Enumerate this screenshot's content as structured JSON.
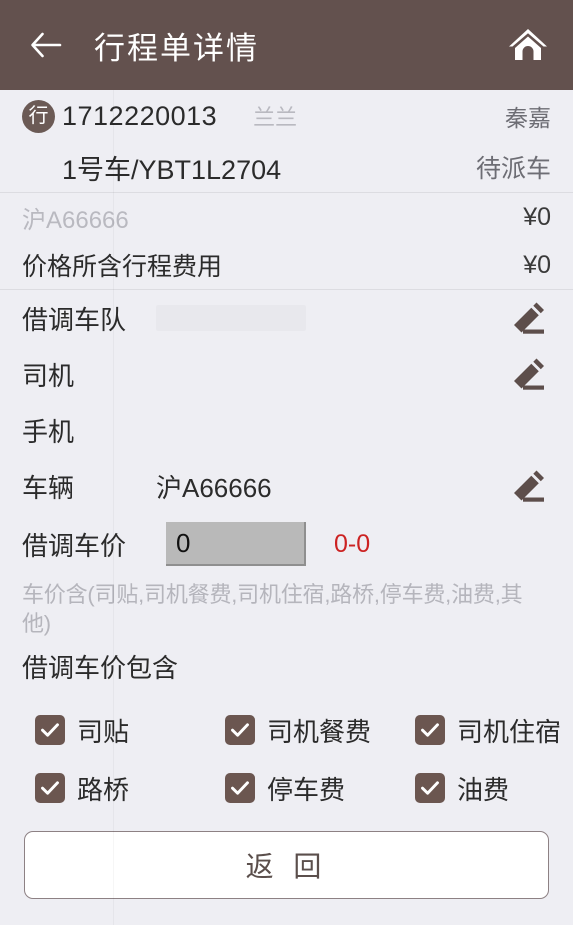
{
  "header": {
    "back_icon": "back-arrow-icon",
    "title": "行程单详情",
    "home_icon": "home-icon",
    "bg_color": "#63514E"
  },
  "order": {
    "badge_text": "行",
    "order_no": "1712220013",
    "customer": "兰兰",
    "agent": "秦嘉",
    "car_label": "1号车/YBT1L2704",
    "status": "待派车"
  },
  "fees": [
    {
      "label": "沪A66666",
      "amount": "¥0",
      "muted": true
    },
    {
      "label": "价格所含行程费用",
      "amount": "¥0",
      "muted": false
    }
  ],
  "details": [
    {
      "label": "借调车队",
      "value": "",
      "edit_icon": "pencil-icon",
      "editable": true
    },
    {
      "label": "司机",
      "value": "",
      "edit_icon": "pencil-icon",
      "editable": true
    },
    {
      "label": "手机",
      "value": "",
      "edit_icon": "",
      "editable": false
    },
    {
      "label": "车辆",
      "value": "沪A66666",
      "edit_icon": "pencil-icon",
      "editable": true
    }
  ],
  "price": {
    "label": "借调车价",
    "input_value": "0",
    "input_placeholder": "0",
    "range": "0-0",
    "range_color": "#CC2222",
    "hint": "车价含(司贴,司机餐费,司机住宿,路桥,停车费,油费,其他)"
  },
  "includes": {
    "title": "借调车价包含",
    "checkbox_color": "#6B5650",
    "items": [
      {
        "label": "司贴",
        "checked": true
      },
      {
        "label": "司机餐费",
        "checked": true
      },
      {
        "label": "司机住宿",
        "checked": true
      },
      {
        "label": "路桥",
        "checked": true
      },
      {
        "label": "停车费",
        "checked": true
      },
      {
        "label": "油费",
        "checked": true
      }
    ]
  },
  "footer": {
    "back_button_label": "返 回"
  }
}
